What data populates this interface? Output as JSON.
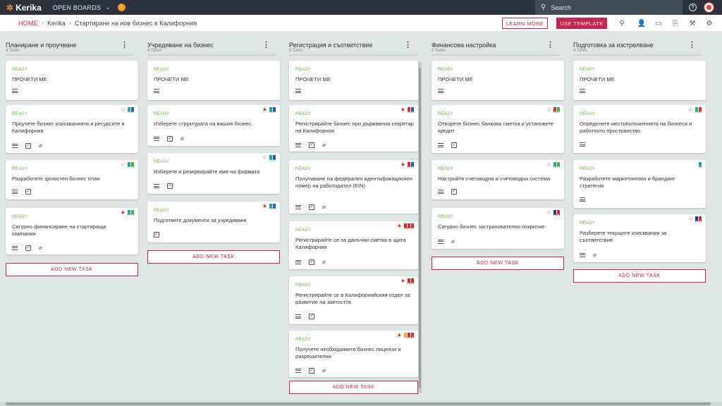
{
  "app": {
    "logo": "Kerika",
    "open_boards_label": "OPEN BOARDS",
    "alert_count": "!",
    "search": {
      "placeholder": "Search"
    },
    "help_symbol": "?"
  },
  "header": {
    "breadcrumb": [
      "HOME",
      "Kerika",
      "Стартиране на нов бизнес в Калифорния"
    ],
    "learn_more": "LEARN MORE",
    "use_template": "USE TEMPLATE"
  },
  "colors": {
    "accent": "#c8254e",
    "ready": "#6bb13b",
    "topbar": "#2b323b",
    "flag_red": "#d32f2f",
    "flag_blue": "#1f5fbf",
    "flag_green": "#4caf50",
    "flag_teal": "#26a69a",
    "flag_orange": "#f5a623",
    "flag_navy": "#283593"
  },
  "add_task_label": "ADD NEW TASK",
  "columns": [
    {
      "title": "Планиране и проучване",
      "count": "4 Tasks",
      "cards": [
        {
          "status": "READY",
          "title": "ПРОЧЕТИ МЕ",
          "flags": [],
          "star": "",
          "icons": [
            "lines"
          ]
        },
        {
          "status": "READY",
          "title": "Проучете бизнес изискванията и ресурсите в Калифорния",
          "star": "off",
          "flags": [
            "teal",
            "blue"
          ],
          "icons": [
            "lines",
            "check",
            "clip"
          ]
        },
        {
          "status": "READY",
          "title": "Разработете цялостен бизнес план",
          "star": "off",
          "flags": [
            "teal",
            "green"
          ],
          "icons": [
            "lines",
            "check"
          ]
        },
        {
          "status": "READY",
          "title": "Сигурно финансиране на стартиращи компании",
          "star": "on",
          "flags": [
            "teal",
            "green"
          ],
          "icons": [
            "lines",
            "check",
            "clip"
          ]
        }
      ]
    },
    {
      "title": "Учредяване на бизнес",
      "count": "4 Tasks",
      "cards": [
        {
          "status": "READY",
          "title": "ПРОЧЕТИ МЕ",
          "flags": [],
          "star": "",
          "icons": [
            "lines"
          ]
        },
        {
          "status": "READY",
          "title": "Изберете структурата на вашия бизнес",
          "star": "on",
          "flags": [
            "teal",
            "blue"
          ],
          "icons": [
            "lines",
            "check",
            "clip"
          ]
        },
        {
          "status": "READY",
          "title": "Изберете и резервирайте име на фирмата",
          "star": "off",
          "flags": [
            "teal",
            "blue"
          ],
          "icons": [
            "lines",
            "check"
          ]
        },
        {
          "status": "READY",
          "title": "Подгответе документи за учредяване",
          "star": "on",
          "flags": [
            "teal",
            "blue"
          ],
          "icons": [
            "check"
          ]
        }
      ]
    },
    {
      "title": "Регистрация и съответствие",
      "count": "6 Tasks",
      "cards": [
        {
          "status": "READY",
          "title": "ПРОЧЕТИ МЕ",
          "flags": [],
          "star": "",
          "icons": [
            "lines"
          ]
        },
        {
          "status": "READY",
          "title": "Регистрирайте бизнес при държавния секретар на Калифорния",
          "star": "on",
          "flags": [
            "red",
            "blue"
          ],
          "icons": [
            "lines",
            "check",
            "clip"
          ]
        },
        {
          "status": "READY",
          "title": "Получаване на федерален идентификационен номер на работодател (EIN)",
          "star": "on",
          "flags": [
            "red",
            "blue"
          ],
          "icons": [
            "lines",
            "check",
            "clip"
          ]
        },
        {
          "status": "READY",
          "title": "Регистрирайте се за данъчни сметки в щата Калифорния",
          "star": "on",
          "flags": [
            "red",
            "red",
            "red"
          ],
          "icons": [
            "lines",
            "check",
            "clip"
          ]
        },
        {
          "status": "READY",
          "title": "Регистрирайте се в Калифорнийския отдел за развитие на заетостта",
          "star": "on",
          "flags": [
            "red",
            "red"
          ],
          "icons": [
            "lines",
            "check"
          ]
        },
        {
          "status": "READY",
          "title": "Получете необходимите бизнес лицензи и разрешителни",
          "star": "on",
          "flags": [
            "orange",
            "red",
            "red"
          ],
          "icons": [
            "lines",
            "check",
            "clip"
          ]
        }
      ]
    },
    {
      "title": "Финансова настройка",
      "count": "4 Tasks",
      "cards": [
        {
          "status": "READY",
          "title": "ПРОЧЕТИ МЕ",
          "flags": [],
          "star": "",
          "icons": [
            "lines"
          ]
        },
        {
          "status": "READY",
          "title": "Отворете бизнес банкова сметка и установете кредит",
          "star": "off",
          "flags": [
            "red",
            "green"
          ],
          "icons": [
            "lines",
            "check"
          ]
        },
        {
          "status": "READY",
          "title": "Настройте счетоводна и счетоводна система",
          "star": "off",
          "flags": [
            "teal",
            "green"
          ],
          "icons": [
            "lines",
            "check"
          ]
        },
        {
          "status": "READY",
          "title": "Сигурно бизнес застрахователно покритие",
          "star": "off",
          "flags": [
            "navy",
            "red"
          ],
          "icons": [
            "lines",
            "clip"
          ]
        }
      ]
    },
    {
      "title": "Подготовка за изстрелване",
      "count": "4 Tasks",
      "cards": [
        {
          "status": "READY",
          "title": "ПРОЧЕТИ МЕ",
          "flags": [],
          "star": "",
          "icons": [
            "lines"
          ]
        },
        {
          "status": "READY",
          "title": "Определете местоположението на бизнеса и работното пространство",
          "star": "off",
          "flags": [
            "teal",
            "red"
          ],
          "icons": [
            "lines"
          ]
        },
        {
          "status": "READY",
          "title": "Разработете маркетингова и брандинг стратегия",
          "star": "",
          "flags": [
            "teal"
          ],
          "icons": [
            "lines"
          ]
        },
        {
          "status": "READY",
          "title": "Разберете текущите изисквания за съответствие",
          "star": "off",
          "flags": [
            "navy",
            "red"
          ],
          "icons": [
            "lines",
            "clip"
          ]
        }
      ]
    }
  ]
}
